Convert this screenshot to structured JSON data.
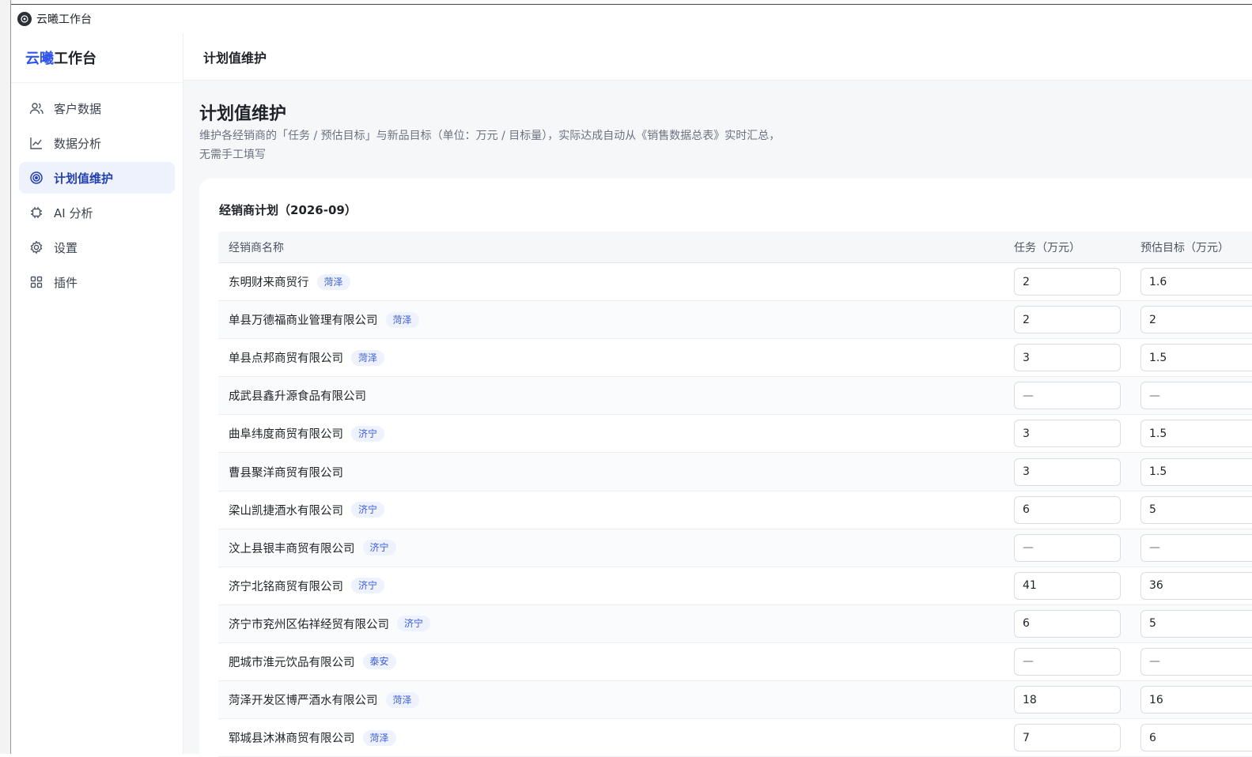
{
  "window": {
    "title": "云曦工作台"
  },
  "sidebar": {
    "brand_accent": "云曦",
    "brand_rest": "工作台",
    "items": [
      {
        "label": "客户数据",
        "icon": "users-icon"
      },
      {
        "label": "数据分析",
        "icon": "line-chart-icon"
      },
      {
        "label": "计划值维护",
        "icon": "target-icon",
        "active": true
      },
      {
        "label": "AI 分析",
        "icon": "chip-icon"
      },
      {
        "label": "设置",
        "icon": "gear-icon"
      },
      {
        "label": "插件",
        "icon": "grid-icon"
      }
    ]
  },
  "topbar": {
    "title": "计划值维护"
  },
  "page": {
    "title": "计划值维护",
    "desc_line1": "维护各经销商的「任务 / 预估目标」与新品目标（单位：万元 / 目标量），实际达成自动从《销售数据总表》实时汇总，",
    "desc_line2": "无需手工填写"
  },
  "card": {
    "title": "经销商计划（2026-09）"
  },
  "table": {
    "headers": {
      "name": "经销商名称",
      "task": "任务（万元）",
      "est": "预估目标（万元）"
    },
    "rows": [
      {
        "name": "东明财来商贸行",
        "tag": "菏泽",
        "task": "2",
        "est": "1.6"
      },
      {
        "name": "单县万德福商业管理有限公司",
        "tag": "菏泽",
        "task": "2",
        "est": "2"
      },
      {
        "name": "单县点邦商贸有限公司",
        "tag": "菏泽",
        "task": "3",
        "est": "1.5"
      },
      {
        "name": "成武县鑫升源食品有限公司",
        "tag": "",
        "task": "—",
        "est": "—"
      },
      {
        "name": "曲阜纬度商贸有限公司",
        "tag": "济宁",
        "task": "3",
        "est": "1.5"
      },
      {
        "name": "曹县聚洋商贸有限公司",
        "tag": "",
        "task": "3",
        "est": "1.5"
      },
      {
        "name": "梁山凯捷酒水有限公司",
        "tag": "济宁",
        "task": "6",
        "est": "5"
      },
      {
        "name": "汶上县银丰商贸有限公司",
        "tag": "济宁",
        "task": "—",
        "est": "—"
      },
      {
        "name": "济宁北铭商贸有限公司",
        "tag": "济宁",
        "task": "41",
        "est": "36"
      },
      {
        "name": "济宁市兖州区佑祥经贸有限公司",
        "tag": "济宁",
        "task": "6",
        "est": "5"
      },
      {
        "name": "肥城市淮元饮品有限公司",
        "tag": "泰安",
        "task": "—",
        "est": "—"
      },
      {
        "name": "菏泽开发区博严酒水有限公司",
        "tag": "菏泽",
        "task": "18",
        "est": "16"
      },
      {
        "name": "郓城县沐淋商贸有限公司",
        "tag": "菏泽",
        "task": "7",
        "est": "6"
      }
    ]
  }
}
